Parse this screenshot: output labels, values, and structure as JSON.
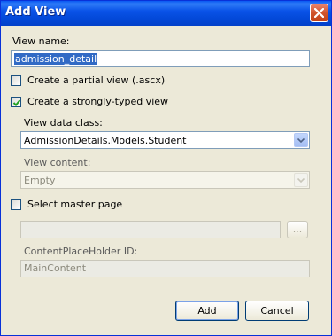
{
  "window": {
    "title": "Add View"
  },
  "form": {
    "view_name_label": "View name:",
    "view_name_value": "admission_detail",
    "partial_view_label": "Create a partial view (.ascx)",
    "partial_view_checked": false,
    "strongly_typed_label": "Create a strongly-typed view",
    "strongly_typed_checked": true,
    "view_data_class_label": "View data class:",
    "view_data_class_value": "AdmissionDetails.Models.Student",
    "view_content_label": "View content:",
    "view_content_value": "Empty",
    "master_page_label": "Select master page",
    "master_page_checked": false,
    "master_page_path": "",
    "browse_label": "...",
    "placeholder_id_label": "ContentPlaceHolder ID:",
    "placeholder_id_value": "MainContent"
  },
  "buttons": {
    "add": "Add",
    "cancel": "Cancel"
  },
  "colors": {
    "titlebar": "#0349d9",
    "dialog_bg": "#ece9d8",
    "selection": "#316ac5",
    "close_button": "#c24216"
  }
}
